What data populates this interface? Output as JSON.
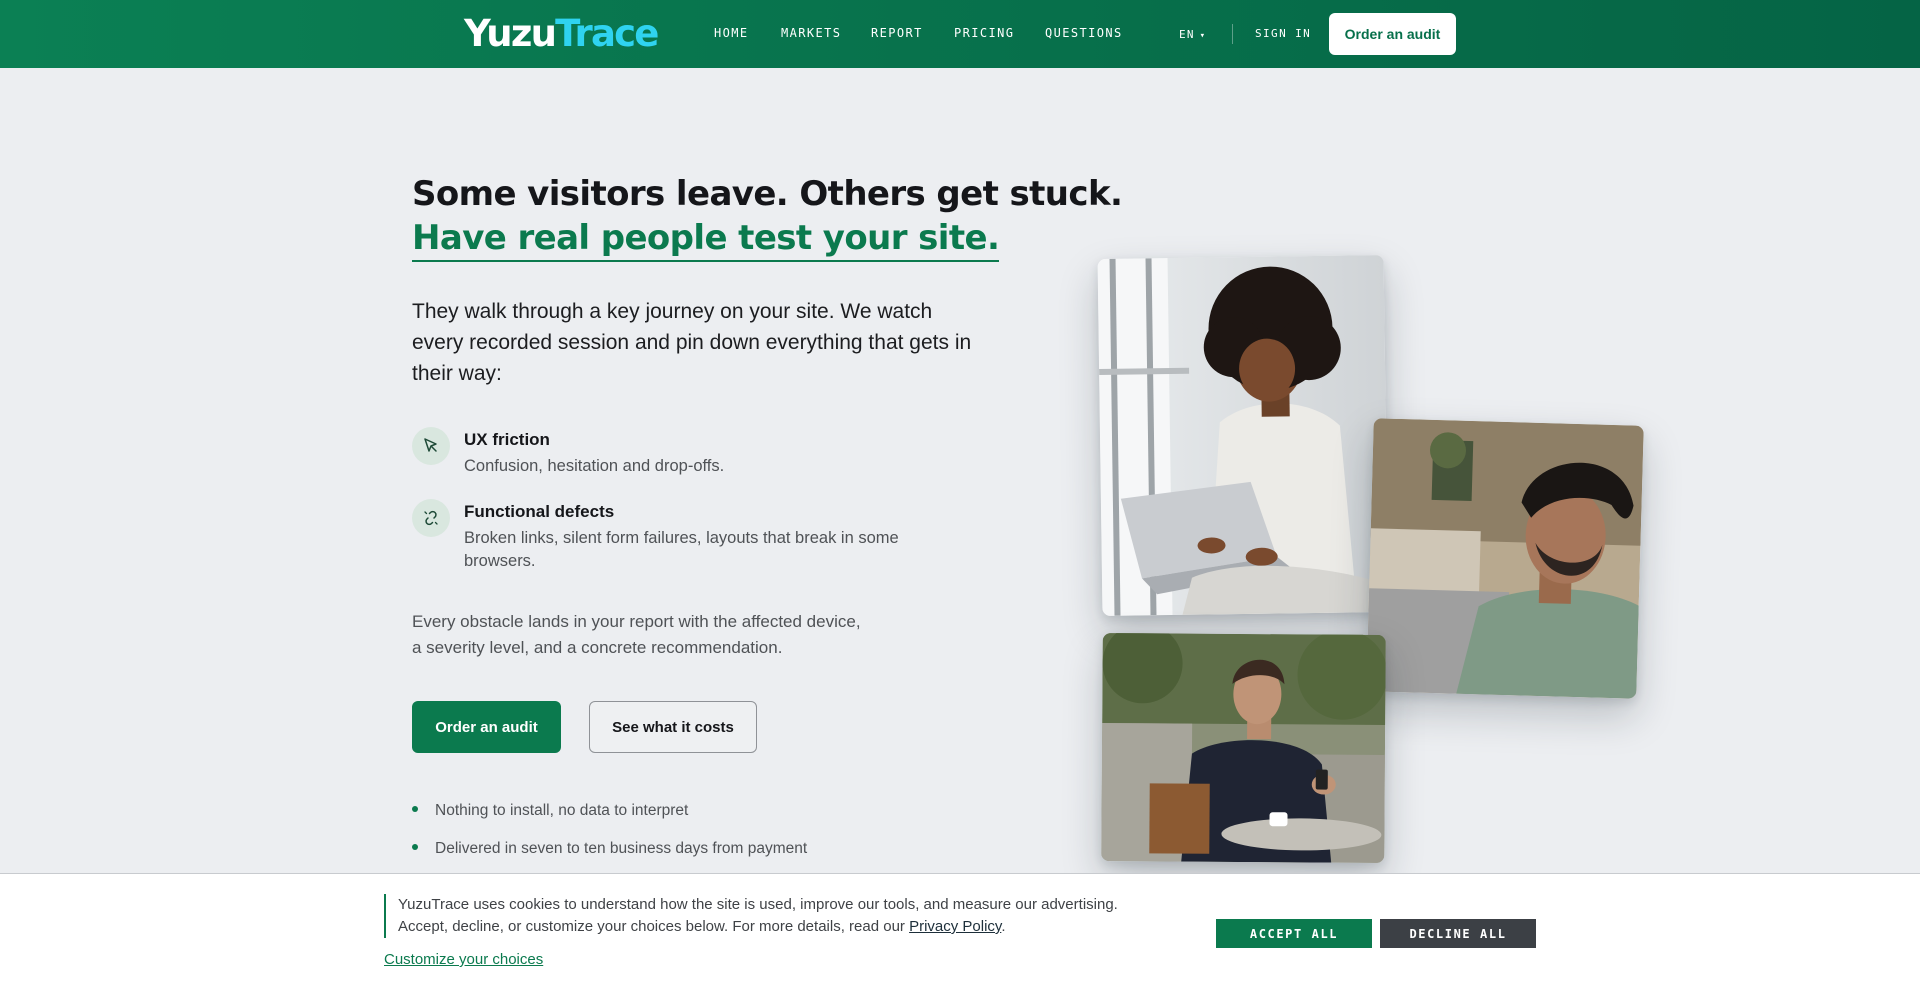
{
  "brand": {
    "logo_part1": "Yuzu",
    "logo_part2": "Trace"
  },
  "nav": {
    "items": [
      {
        "label": "HOME"
      },
      {
        "label": "MARKETS"
      },
      {
        "label": "REPORT"
      },
      {
        "label": "PRICING"
      },
      {
        "label": "QUESTIONS"
      }
    ],
    "language": "EN",
    "sign_in": "SIGN IN",
    "cta": "Order an audit"
  },
  "hero": {
    "headline_line1": "Some visitors leave. Others get stuck.",
    "headline_line2": "Have real people test your site.",
    "lead": "They walk through a key journey on your site. We watch every recorded session and pin down everything that gets in their way:",
    "features": [
      {
        "icon": "cursor-click-icon",
        "title": "UX friction",
        "description": "Confusion, hesitation and drop-offs."
      },
      {
        "icon": "broken-link-icon",
        "title": "Functional defects",
        "description": "Broken links, silent form failures, layouts that break in some browsers."
      }
    ],
    "closing_line1": "Every obstacle lands in your report with the affected device,",
    "closing_line2": "a severity level, and a concrete recommendation.",
    "primary_button": "Order an audit",
    "secondary_button": "See what it costs",
    "bullets": [
      "Nothing to install, no data to interpret",
      "Delivered in seven to ten business days from payment"
    ]
  },
  "cookie_banner": {
    "text_line1": "YuzuTrace uses cookies to understand how the site is used, improve our tools, and measure our advertising.",
    "text_line2_prefix": "Accept, decline, or customize your choices below. For more details, read our ",
    "privacy_link": "Privacy Policy",
    "text_line2_suffix": ".",
    "customize_link": "Customize your choices",
    "accept_button": "ACCEPT ALL",
    "decline_button": "DECLINE ALL"
  },
  "colors": {
    "brand_green": "#0b7a4e",
    "header_green": "#07704b",
    "logo_accent": "#2fd3f0",
    "page_background": "#eceef1"
  }
}
